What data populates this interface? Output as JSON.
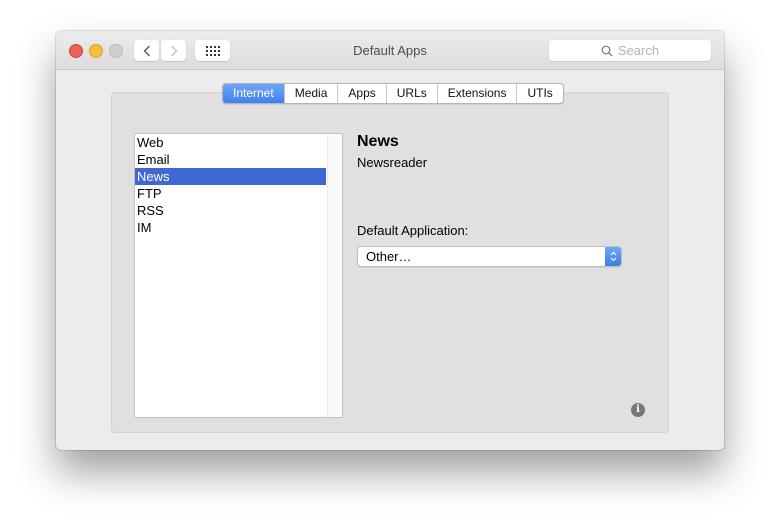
{
  "window": {
    "title": "Default Apps",
    "search_placeholder": "Search"
  },
  "toolbar": {
    "back_icon": "chevron-left-icon",
    "forward_icon": "chevron-right-icon",
    "grid_icon": "show-all-grid-icon"
  },
  "tabs": [
    {
      "label": "Internet",
      "active": true
    },
    {
      "label": "Media",
      "active": false
    },
    {
      "label": "Apps",
      "active": false
    },
    {
      "label": "URLs",
      "active": false
    },
    {
      "label": "Extensions",
      "active": false
    },
    {
      "label": "UTIs",
      "active": false
    }
  ],
  "list": {
    "items": [
      {
        "label": "Web"
      },
      {
        "label": "Email"
      },
      {
        "label": "News",
        "selected": true
      },
      {
        "label": "FTP"
      },
      {
        "label": "RSS"
      },
      {
        "label": "IM"
      }
    ]
  },
  "detail": {
    "title": "News",
    "subtitle": "Newsreader",
    "default_app_label": "Default Application:",
    "default_app_value": "Other…"
  },
  "info_icon": "i",
  "colors": {
    "accent": "#4068d3",
    "tab_active": "#4f8cf2"
  }
}
